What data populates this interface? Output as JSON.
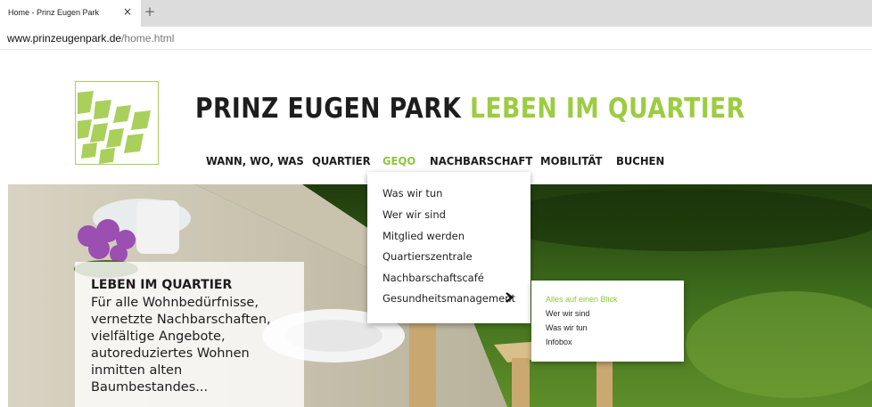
{
  "browser": {
    "tab_title": "Home - Prinz Eugen Park",
    "tab_close": "×",
    "new_tab": "+",
    "url_host": "www.prinzeugenpark.de",
    "url_path": "/home.html"
  },
  "header": {
    "title_dark": "PRINZ EUGEN PARK",
    "title_green": "LEBEN IM QUARTIER"
  },
  "nav": {
    "items": [
      {
        "label": "WANN, WO, WAS"
      },
      {
        "label": "QUARTIER"
      },
      {
        "label": "GEQO",
        "active": true
      },
      {
        "label": "NACHBARSCHAFT"
      },
      {
        "label": "MOBILITÄT"
      },
      {
        "label": "BUCHEN"
      }
    ]
  },
  "dropdown": {
    "items": [
      {
        "label": "Was wir tun"
      },
      {
        "label": "Wer wir sind"
      },
      {
        "label": "Mitglied werden"
      },
      {
        "label": "Quartierszentrale"
      },
      {
        "label": "Nachbarschaftscafé"
      },
      {
        "label": "Gesundheitsmanagement",
        "has_submenu": true
      }
    ]
  },
  "submenu": {
    "items": [
      {
        "label": "Alles auf einen Blick",
        "active": true
      },
      {
        "label": "Wer wir sind"
      },
      {
        "label": "Was wir tun"
      },
      {
        "label": "Infobox"
      }
    ]
  },
  "hero": {
    "title": "LEBEN IM QUARTIER",
    "lines": [
      "Für alle Wohnbedürfnisse,",
      "vernetzte Nachbarschaften,",
      "vielfältige Angebote,",
      "autoreduziertes Wohnen",
      "inmitten alten",
      "Baumbestandes..."
    ]
  },
  "colors": {
    "brand_green": "#9ccc41",
    "active_green": "#8cc63f",
    "text_dark": "#1d1d1d"
  },
  "icons": [
    "logo-icon",
    "chevron-right-icon",
    "close-icon",
    "plus-icon"
  ]
}
